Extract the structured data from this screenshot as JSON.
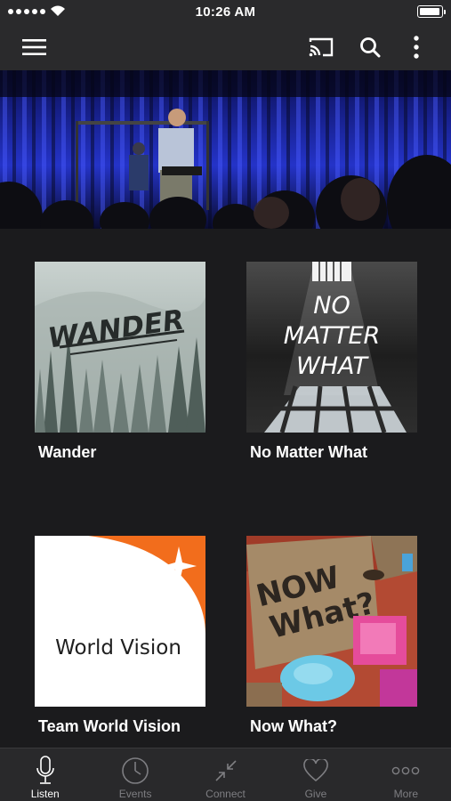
{
  "status_bar": {
    "time": "10:26 AM",
    "battery_level": 1.0
  },
  "app_bar": {
    "icons": [
      "menu-icon",
      "cast-icon",
      "search-icon",
      "more-vertical-icon"
    ]
  },
  "hero": {
    "icon": "hero-photo"
  },
  "series": [
    {
      "title": "Wander",
      "art_text": "WANDER"
    },
    {
      "title": "No Matter What",
      "art_text": [
        "NO",
        "MATTER",
        "WHAT"
      ]
    },
    {
      "title": "Team World Vision",
      "art_text": "World Vision"
    },
    {
      "title": "Now What?",
      "art_text": [
        "NOW",
        "What?"
      ]
    }
  ],
  "tabs": [
    {
      "label": "Listen",
      "icon": "microphone-icon",
      "active": true
    },
    {
      "label": "Events",
      "icon": "clock-icon",
      "active": false
    },
    {
      "label": "Connect",
      "icon": "connect-arrows-icon",
      "active": false
    },
    {
      "label": "Give",
      "icon": "heart-icon",
      "active": false
    },
    {
      "label": "More",
      "icon": "more-dots-icon",
      "active": false
    }
  ],
  "colors": {
    "app_bar": "#2a2a2c",
    "background": "#1b1b1d",
    "tab_active": "#ffffff",
    "tab_inactive": "#7e7e82",
    "world_vision_orange": "#f26d1c"
  }
}
